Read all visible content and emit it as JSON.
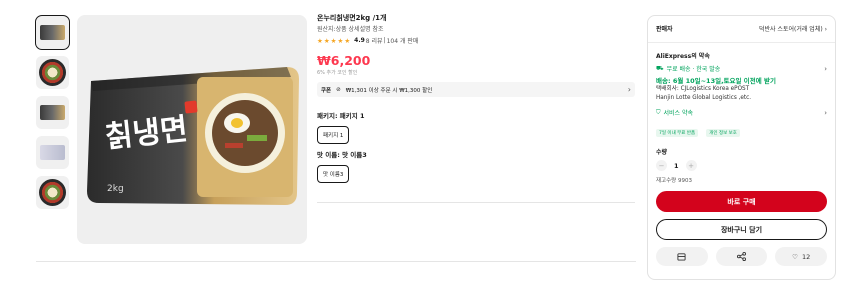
{
  "thumbnails": [
    {
      "name": "product-thumbnail-1",
      "kind": "pack",
      "active": true
    },
    {
      "name": "product-thumbnail-2",
      "kind": "food",
      "active": false
    },
    {
      "name": "product-thumbnail-3",
      "kind": "pack",
      "active": false
    },
    {
      "name": "product-thumbnail-4",
      "kind": "pack",
      "active": false
    },
    {
      "name": "product-thumbnail-5",
      "kind": "food",
      "active": false
    }
  ],
  "product": {
    "title": "온누리칡냉면2kg /1개",
    "subtitle": "원산지:상품 상세설명 참조",
    "rating": "4.9",
    "reviews": "8 리뷰",
    "sales": "104 개 판매",
    "price": "₩6,200",
    "price_sub": "6% 추가 코인 할인",
    "package_logo": "칡냉면",
    "package_weight": "2kg"
  },
  "coupon": {
    "label": "쿠폰",
    "text": "₩1,301 이상 주문 시 ₩1,300 할인"
  },
  "options": {
    "package_label": "패키지: 패키지 1",
    "package_value": "패키지 1",
    "taste_label": "맛 이름: 맛 이름3",
    "taste_value": "맛 이름3"
  },
  "seller": {
    "label": "판매자",
    "name": "덕반사 스토어(거래 업체)"
  },
  "promise": {
    "title": "AliExpress의 약속",
    "shipping": "무료 배송 · 한국 발송",
    "delivery": "배송: 6월 10일~13일,토요일 이전에 받기",
    "carriers_1": "택배회사: CJLogistics Korea ePOST",
    "carriers_2": "Hanjin Lotte Global Logistics ,etc.",
    "service": "서비스 약속",
    "chip_1": "7일 이내 무료 반품",
    "chip_2": "개인 정보 보호"
  },
  "quantity": {
    "label": "수량",
    "value": "1",
    "stock": "재고수량 9903"
  },
  "actions": {
    "buy": "바로 구매",
    "cart": "장바구니 담기",
    "wishlist_count": "12"
  },
  "colors": {
    "price": "#fd384f",
    "buy_button": "#d3031c",
    "promise_green": "#00a35c",
    "star": "#f5a623"
  },
  "icons": [
    "share-icon",
    "heart-icon",
    "truck-icon",
    "shield-icon",
    "chevron-right-icon",
    "coupon-tag-icon",
    "cart-icon"
  ]
}
